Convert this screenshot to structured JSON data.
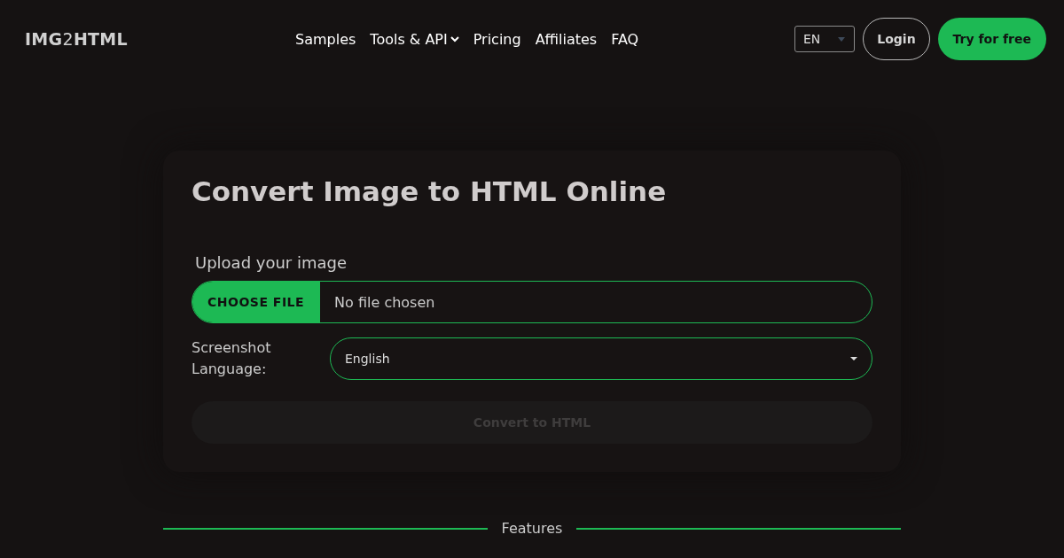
{
  "header": {
    "logo": "**IMG**2**HTML**",
    "nav": [
      {
        "label": "Samples",
        "has_menu": false
      },
      {
        "label": "Tools & API",
        "has_menu": true
      },
      {
        "label": "Pricing",
        "has_menu": false
      },
      {
        "label": "Affiliates",
        "has_menu": false
      },
      {
        "label": "FAQ",
        "has_menu": false
      }
    ],
    "language": "EN",
    "login": "Login",
    "cta": "Try for free"
  },
  "converter": {
    "title": "Convert Image to HTML Online",
    "upload_label": "Upload your image",
    "file_button": "CHOOSE FILE",
    "file_status": "No file chosen",
    "language_label": "Screenshot Language:",
    "language_value": "English",
    "convert_button": {
      "label": "Convert to HTML",
      "disabled": true
    }
  },
  "section_heading": "Features"
}
